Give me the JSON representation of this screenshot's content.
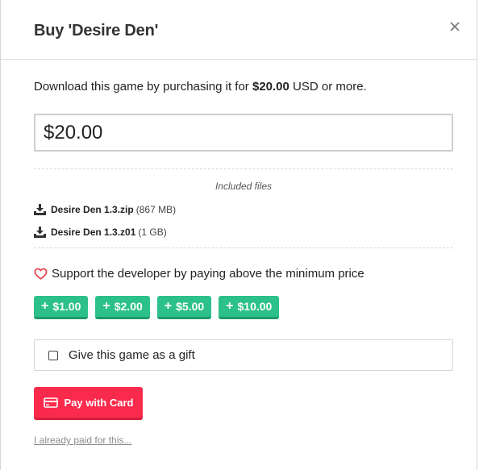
{
  "dialog": {
    "title": "Buy 'Desire Den'",
    "close_icon": "close-icon"
  },
  "intro": {
    "prefix": "Download this game by purchasing it for ",
    "price": "$20.00",
    "suffix": " USD or more."
  },
  "price_input": {
    "value": "$20.00"
  },
  "included": {
    "label": "Included files",
    "files": [
      {
        "name": "Desire Den 1.3.zip",
        "size": "(867 MB)",
        "icon": "download-icon"
      },
      {
        "name": "Desire Den 1.3.z01",
        "size": "(1 GB)",
        "icon": "download-icon"
      }
    ]
  },
  "support": {
    "icon": "heart-icon",
    "text": "Support the developer by paying above the minimum price",
    "tips": [
      {
        "plus": "+",
        "label": "$1.00"
      },
      {
        "plus": "+",
        "label": "$2.00"
      },
      {
        "plus": "+",
        "label": "$5.00"
      },
      {
        "plus": "+",
        "label": "$10.00"
      }
    ]
  },
  "gift": {
    "label": "Give this game as a gift",
    "checked": false
  },
  "pay": {
    "icon": "credit-card-icon",
    "label": "Pay with Card"
  },
  "already_paid": {
    "label": "I already paid for this..."
  },
  "colors": {
    "tip_green": "#2cc08b",
    "pay_red": "#fa2a4c",
    "heart_red": "#e8414f"
  }
}
